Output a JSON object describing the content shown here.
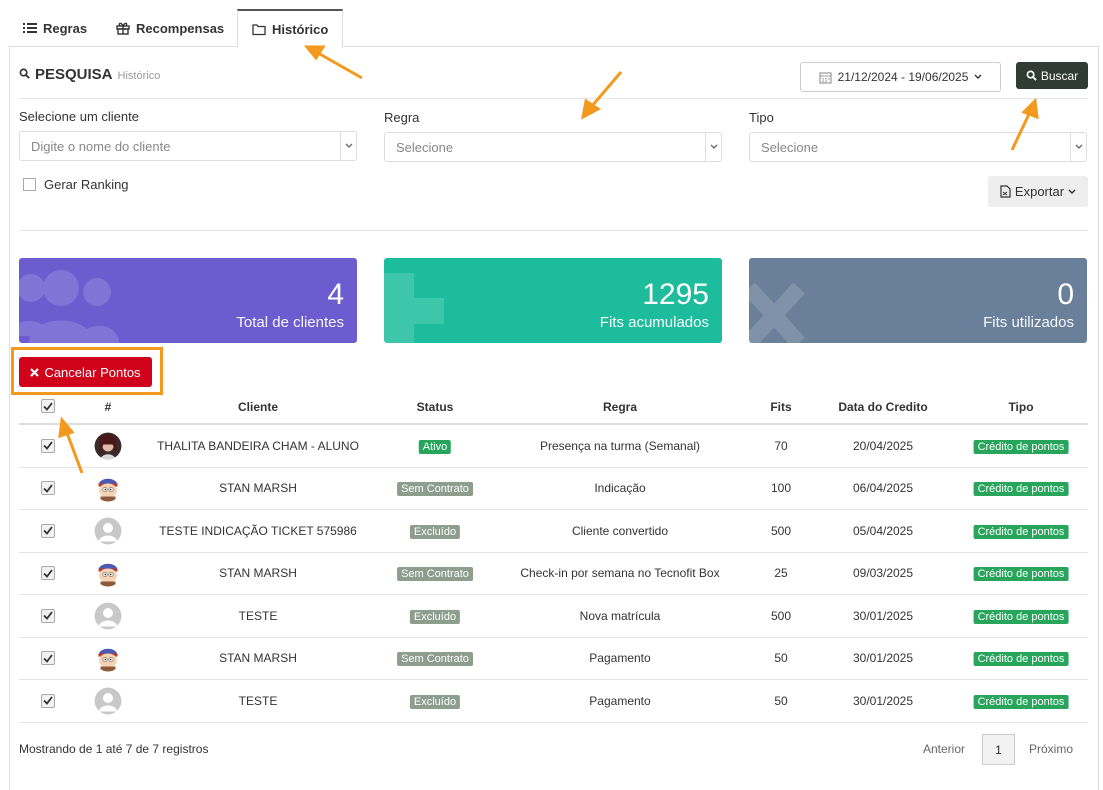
{
  "tabs": [
    {
      "label": "Regras",
      "icon": "list-icon"
    },
    {
      "label": "Recompensas",
      "icon": "gift-icon"
    },
    {
      "label": "Histórico",
      "icon": "folder-icon",
      "active": true
    }
  ],
  "search": {
    "title": "PESQUISA",
    "subtitle": "Histórico",
    "date_range": "21/12/2024 - 19/06/2025",
    "buscar_label": "Buscar"
  },
  "filters": {
    "cliente_label": "Selecione um cliente",
    "cliente_placeholder": "Digite o nome do cliente",
    "regra_label": "Regra",
    "regra_placeholder": "Selecione",
    "tipo_label": "Tipo",
    "tipo_placeholder": "Selecione",
    "ranking_label": "Gerar Ranking",
    "exportar_label": "Exportar"
  },
  "stats": [
    {
      "value": "4",
      "label": "Total de clientes",
      "color": "#6c5ccf",
      "icon": "users-icon"
    },
    {
      "value": "1295",
      "label": "Fits acumulados",
      "color": "#1dbc9c",
      "icon": "plus-icon"
    },
    {
      "value": "0",
      "label": "Fits utilizados",
      "color": "#6a7f99",
      "icon": "x-icon"
    }
  ],
  "cancel_label": "Cancelar Pontos",
  "table": {
    "headers": [
      "#",
      "Cliente",
      "Status",
      "Regra",
      "Fits",
      "Data do Credito",
      "Tipo"
    ],
    "rows": [
      {
        "avatar": "photo",
        "cliente": "THALITA BANDEIRA CHAM - ALUNO",
        "status": "Ativo",
        "regra": "Presença na turma (Semanal)",
        "fits": "70",
        "data": "20/04/2025",
        "tipo": "Crédito de pontos"
      },
      {
        "avatar": "cartoon",
        "cliente": "STAN MARSH",
        "status": "Sem Contrato",
        "regra": "Indicação",
        "fits": "100",
        "data": "06/04/2025",
        "tipo": "Crédito de pontos"
      },
      {
        "avatar": "default",
        "cliente": "TESTE INDICAÇÃO TICKET 575986",
        "status": "Excluído",
        "regra": "Cliente convertido",
        "fits": "500",
        "data": "05/04/2025",
        "tipo": "Crédito de pontos"
      },
      {
        "avatar": "cartoon",
        "cliente": "STAN MARSH",
        "status": "Sem Contrato",
        "regra": "Check-in por semana no Tecnofit Box",
        "fits": "25",
        "data": "09/03/2025",
        "tipo": "Crédito de pontos"
      },
      {
        "avatar": "default",
        "cliente": "TESTE",
        "status": "Excluído",
        "regra": "Nova matrícula",
        "fits": "500",
        "data": "30/01/2025",
        "tipo": "Crédito de pontos"
      },
      {
        "avatar": "cartoon",
        "cliente": "STAN MARSH",
        "status": "Sem Contrato",
        "regra": "Pagamento",
        "fits": "50",
        "data": "30/01/2025",
        "tipo": "Crédito de pontos"
      },
      {
        "avatar": "default",
        "cliente": "TESTE",
        "status": "Excluído",
        "regra": "Pagamento",
        "fits": "50",
        "data": "30/01/2025",
        "tipo": "Crédito de pontos"
      }
    ]
  },
  "footer": {
    "info": "Mostrando de 1 até 7 de 7 registros",
    "prev": "Anterior",
    "page": "1",
    "next": "Próximo"
  },
  "colors": {
    "accent_orange": "#f39a1e",
    "cancel_red": "#d0021b",
    "buscar_dark": "#2f3b34",
    "badge_green": "#27a65b",
    "badge_gray": "#8e9e8e"
  }
}
